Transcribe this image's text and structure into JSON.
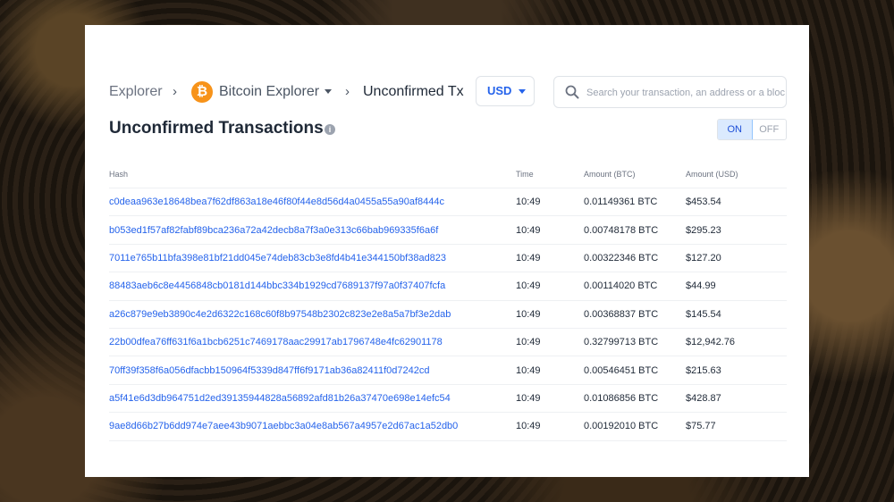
{
  "breadcrumb": {
    "root": "Explorer",
    "separator": "›",
    "coin_logo": "₿",
    "coin_label": "Bitcoin Explorer",
    "current": "Unconfirmed Tx"
  },
  "currency": {
    "selected": "USD"
  },
  "search": {
    "placeholder": "Search your transaction, an address or a block",
    "value": ""
  },
  "page": {
    "title": "Unconfirmed Transactions",
    "info_glyph": "i"
  },
  "toggle": {
    "on": "ON",
    "off": "OFF",
    "active": "ON"
  },
  "table": {
    "columns": [
      "Hash",
      "Time",
      "Amount (BTC)",
      "Amount (USD)"
    ],
    "rows": [
      {
        "hash": "c0deaa963e18648bea7f62df863a18e46f80f44e8d56d4a0455a55a90af8444c",
        "time": "10:49",
        "btc": "0.01149361 BTC",
        "usd": "$453.54"
      },
      {
        "hash": "b053ed1f57af82fabf89bca236a72a42decb8a7f3a0e313c66bab969335f6a6f",
        "time": "10:49",
        "btc": "0.00748178 BTC",
        "usd": "$295.23"
      },
      {
        "hash": "7011e765b11bfa398e81bf21dd045e74deb83cb3e8fd4b41e344150bf38ad823",
        "time": "10:49",
        "btc": "0.00322346 BTC",
        "usd": "$127.20"
      },
      {
        "hash": "88483aeb6c8e4456848cb0181d144bbc334b1929cd7689137f97a0f37407fcfa",
        "time": "10:49",
        "btc": "0.00114020 BTC",
        "usd": "$44.99"
      },
      {
        "hash": "a26c879e9eb3890c4e2d6322c168c60f8b97548b2302c823e2e8a5a7bf3e2dab",
        "time": "10:49",
        "btc": "0.00368837 BTC",
        "usd": "$145.54"
      },
      {
        "hash": "22b00dfea76ff631f6a1bcb6251c7469178aac29917ab1796748e4fc62901178",
        "time": "10:49",
        "btc": "0.32799713 BTC",
        "usd": "$12,942.76"
      },
      {
        "hash": "70ff39f358f6a056dfacbb150964f5339d847ff6f9171ab36a82411f0d7242cd",
        "time": "10:49",
        "btc": "0.00546451 BTC",
        "usd": "$215.63"
      },
      {
        "hash": "a5f41e6d3db964751d2ed39135944828a56892afd81b26a37470e698e14efc54",
        "time": "10:49",
        "btc": "0.01086856 BTC",
        "usd": "$428.87"
      },
      {
        "hash": "9ae8d66b27b6dd974e7aee43b9071aebbc3a04e8ab567a4957e2d67ac1a52db0",
        "time": "10:49",
        "btc": "0.00192010 BTC",
        "usd": "$75.77"
      }
    ]
  },
  "colors": {
    "accent": "#2563eb",
    "bitcoin": "#f7931a",
    "title": "#1f2937"
  }
}
